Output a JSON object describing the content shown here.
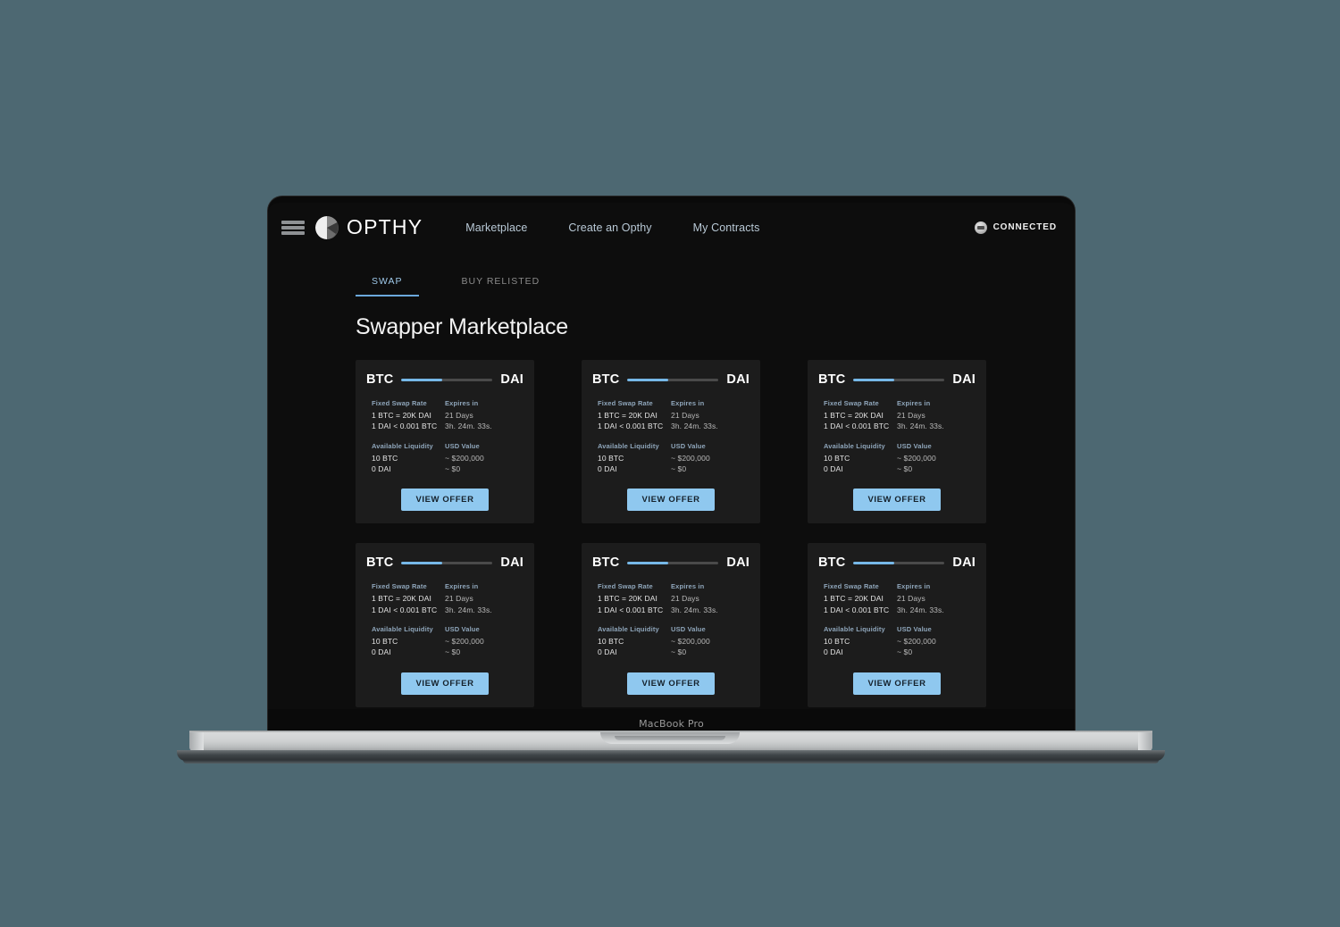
{
  "device": {
    "label": "MacBook Pro"
  },
  "header": {
    "menu_icon": "hamburger-menu-icon",
    "logo_icon": "opthy-logo-icon",
    "brand": "OPTHY",
    "nav": [
      {
        "label": "Marketplace"
      },
      {
        "label": "Create an Opthy"
      },
      {
        "label": "My Contracts"
      }
    ],
    "wallet": {
      "avatar_icon": "wallet-avatar-icon",
      "label": "CONNECTED"
    }
  },
  "tabs": [
    {
      "label": "SWAP",
      "active": true
    },
    {
      "label": "BUY RELISTED",
      "active": false
    }
  ],
  "page_title": "Swapper Marketplace",
  "labels": {
    "fixed_swap_rate": "Fixed Swap Rate",
    "expires_in": "Expires in",
    "available_liquidity": "Available Liquidity",
    "usd_value": "USD Value",
    "view_offer": "VIEW OFFER"
  },
  "colors": {
    "page_background": "#4d6872",
    "screen_background": "#0d0d0d",
    "card_background": "#1c1c1c",
    "accent_blue": "#8fc8ef",
    "bar_fill": "#76b8e8",
    "bar_track": "#4a4a4a",
    "label_blue": "#8fa6bb"
  },
  "cards": [
    {
      "from_symbol": "BTC",
      "to_symbol": "DAI",
      "progress": 45,
      "rate_1": "1 BTC = 20K DAI",
      "rate_2": "1 DAI < 0.001 BTC",
      "expires_days": "21 Days",
      "expires_time": "3h. 24m. 33s.",
      "liquidity_1": "10 BTC",
      "liquidity_2": "0 DAI",
      "usd_1": "~ $200,000",
      "usd_2": "~ $0"
    },
    {
      "from_symbol": "BTC",
      "to_symbol": "DAI",
      "progress": 45,
      "rate_1": "1 BTC = 20K DAI",
      "rate_2": "1 DAI < 0.001 BTC",
      "expires_days": "21 Days",
      "expires_time": "3h. 24m. 33s.",
      "liquidity_1": "10 BTC",
      "liquidity_2": "0 DAI",
      "usd_1": "~ $200,000",
      "usd_2": "~ $0"
    },
    {
      "from_symbol": "BTC",
      "to_symbol": "DAI",
      "progress": 45,
      "rate_1": "1 BTC = 20K DAI",
      "rate_2": "1 DAI < 0.001 BTC",
      "expires_days": "21 Days",
      "expires_time": "3h. 24m. 33s.",
      "liquidity_1": "10 BTC",
      "liquidity_2": "0 DAI",
      "usd_1": "~ $200,000",
      "usd_2": "~ $0"
    },
    {
      "from_symbol": "BTC",
      "to_symbol": "DAI",
      "progress": 45,
      "rate_1": "1 BTC = 20K DAI",
      "rate_2": "1 DAI < 0.001 BTC",
      "expires_days": "21 Days",
      "expires_time": "3h. 24m. 33s.",
      "liquidity_1": "10 BTC",
      "liquidity_2": "0 DAI",
      "usd_1": "~ $200,000",
      "usd_2": "~ $0"
    },
    {
      "from_symbol": "BTC",
      "to_symbol": "DAI",
      "progress": 45,
      "rate_1": "1 BTC = 20K DAI",
      "rate_2": "1 DAI < 0.001 BTC",
      "expires_days": "21 Days",
      "expires_time": "3h. 24m. 33s.",
      "liquidity_1": "10 BTC",
      "liquidity_2": "0 DAI",
      "usd_1": "~ $200,000",
      "usd_2": "~ $0"
    },
    {
      "from_symbol": "BTC",
      "to_symbol": "DAI",
      "progress": 45,
      "rate_1": "1 BTC = 20K DAI",
      "rate_2": "1 DAI < 0.001 BTC",
      "expires_days": "21 Days",
      "expires_time": "3h. 24m. 33s.",
      "liquidity_1": "10 BTC",
      "liquidity_2": "0 DAI",
      "usd_1": "~ $200,000",
      "usd_2": "~ $0"
    }
  ]
}
